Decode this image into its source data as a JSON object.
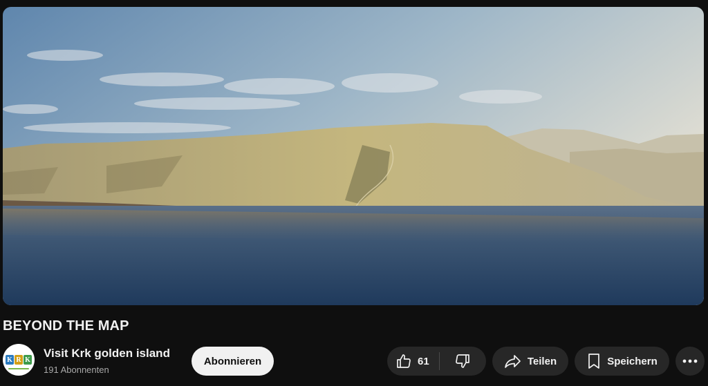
{
  "video": {
    "title": "BEYOND THE MAP"
  },
  "channel": {
    "name": "Visit Krk golden island",
    "subscribers": "191 Abonnenten",
    "avatar_letters": [
      "K",
      "R",
      "K"
    ],
    "avatar_colors": [
      "#2b7bbf",
      "#d4a017",
      "#3d9b4a"
    ]
  },
  "actions": {
    "subscribe_label": "Abonnieren",
    "like_count": "61",
    "share_label": "Teilen",
    "save_label": "Speichern"
  },
  "icons": {
    "like": "thumb-up-icon",
    "dislike": "thumb-down-icon",
    "share": "share-arrow-icon",
    "save": "bookmark-icon",
    "more": "more-horizontal-icon"
  },
  "colors": {
    "background": "#0f0f0f",
    "button": "#272727",
    "subscribe_bg": "#f1f1f1",
    "text_primary": "#f1f1f1",
    "text_secondary": "#aaaaaa"
  }
}
